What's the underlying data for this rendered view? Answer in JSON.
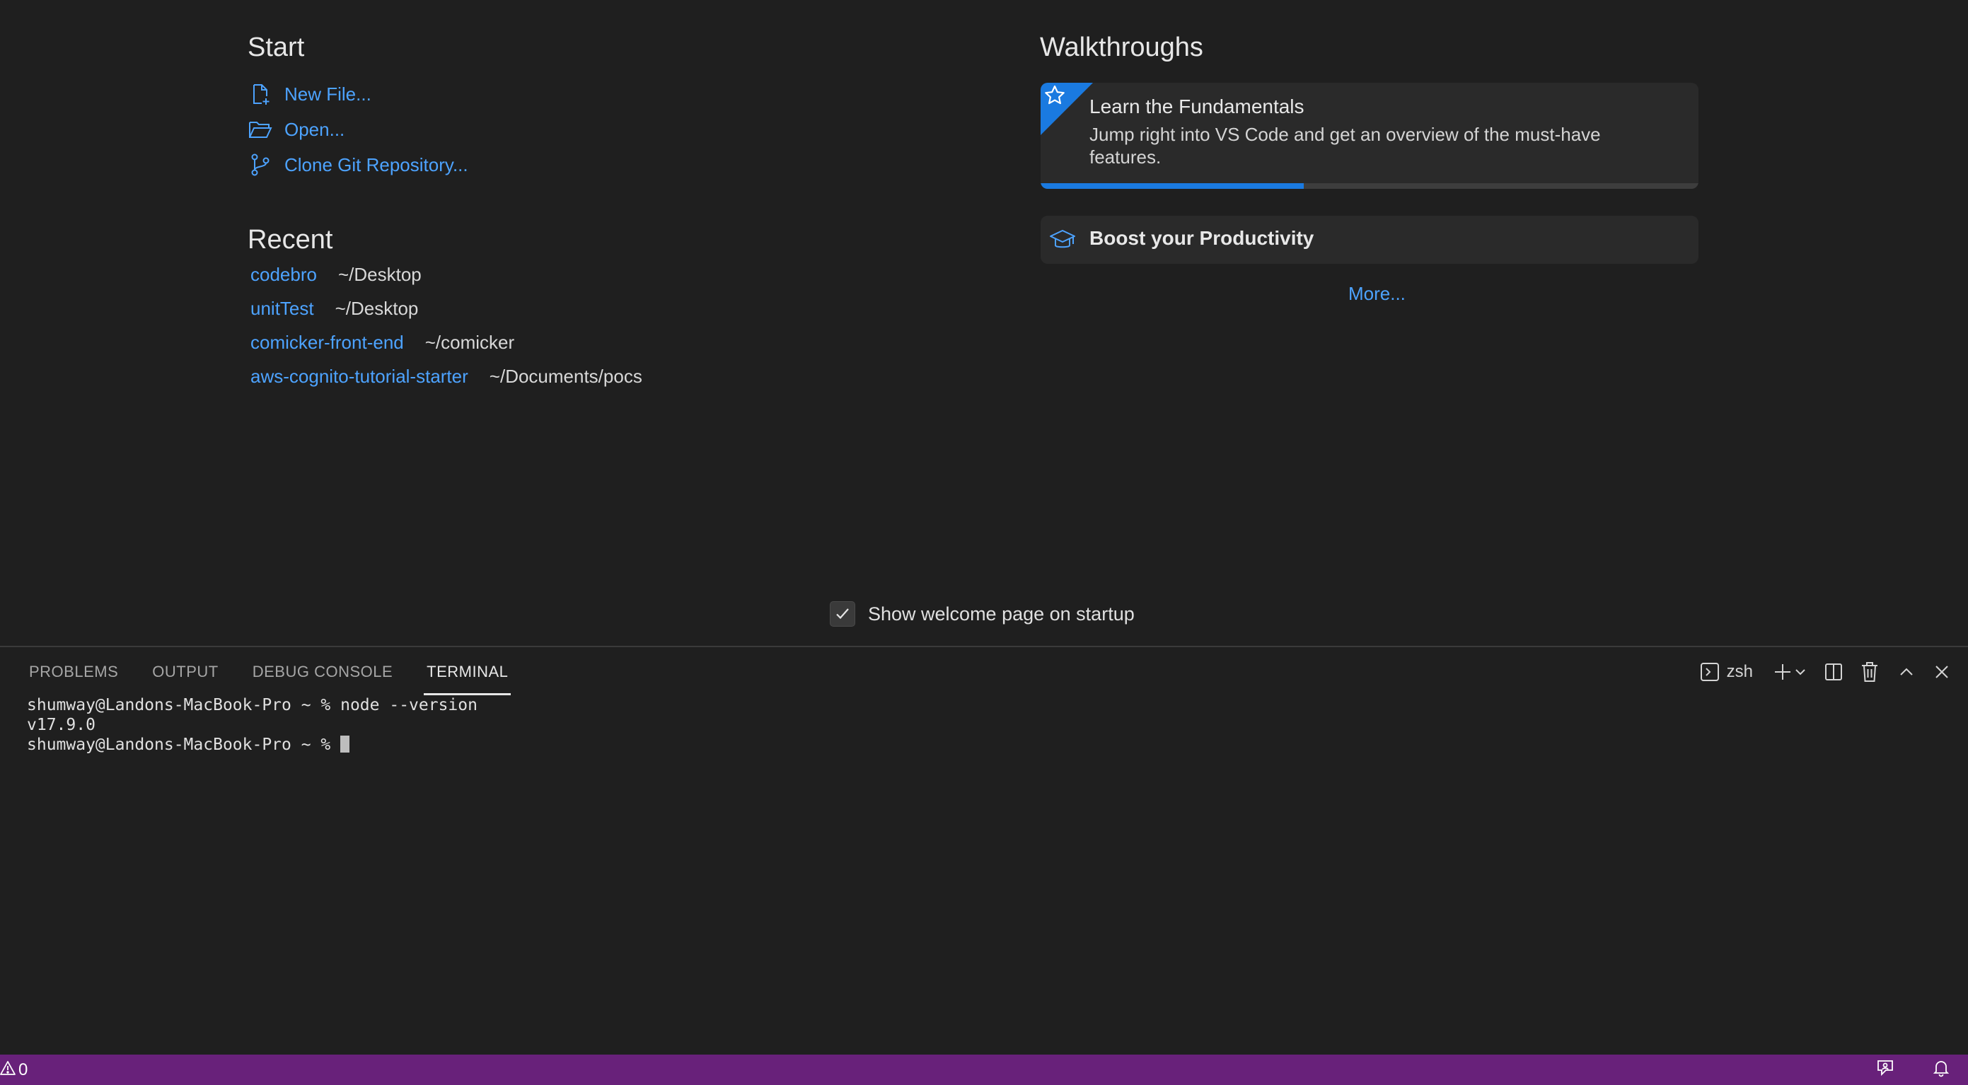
{
  "welcome": {
    "start": {
      "title": "Start",
      "items": [
        {
          "label": "New File...",
          "icon": "new-file-icon"
        },
        {
          "label": "Open...",
          "icon": "folder-open-icon"
        },
        {
          "label": "Clone Git Repository...",
          "icon": "git-branch-icon"
        }
      ]
    },
    "recent": {
      "title": "Recent",
      "items": [
        {
          "name": "codebro",
          "path": "~/Desktop"
        },
        {
          "name": "unitTest",
          "path": "~/Desktop"
        },
        {
          "name": "comicker-front-end",
          "path": "~/comicker"
        },
        {
          "name": "aws-cognito-tutorial-starter",
          "path": "~/Documents/pocs"
        }
      ]
    },
    "walkthroughs": {
      "title": "Walkthroughs",
      "cards": [
        {
          "title": "Learn the Fundamentals",
          "description": "Jump right into VS Code and get an overview of the must-have features.",
          "progress": 0.4,
          "icon": "star-icon"
        },
        {
          "title": "Boost your Productivity",
          "icon": "mortarboard-icon"
        }
      ],
      "more_label": "More..."
    },
    "startup_checkbox": {
      "label": "Show welcome page on startup",
      "checked": true
    }
  },
  "panel": {
    "tabs": [
      {
        "label": "PROBLEMS",
        "active": false
      },
      {
        "label": "OUTPUT",
        "active": false
      },
      {
        "label": "DEBUG CONSOLE",
        "active": false
      },
      {
        "label": "TERMINAL",
        "active": true
      }
    ],
    "shell_label": "zsh",
    "terminal_lines": [
      "shumway@Landons-MacBook-Pro ~ % node --version",
      "v17.9.0",
      "shumway@Landons-MacBook-Pro ~ % "
    ]
  },
  "statusbar": {
    "warnings_count": "0",
    "background_color": "#68217a"
  },
  "colors": {
    "link": "#4da3ff",
    "accent": "#1a7ae0",
    "background": "#1f1f1f"
  }
}
